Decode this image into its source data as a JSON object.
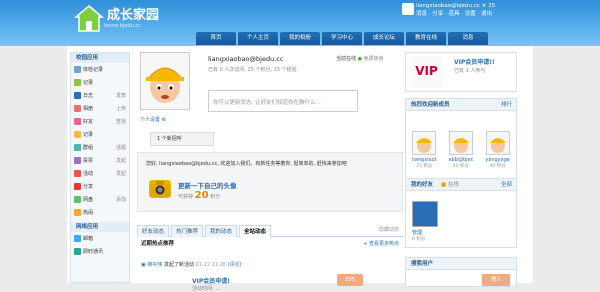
{
  "header": {
    "logo_title": "成长家园",
    "logo_sub": "home.bjedu.cc",
    "user_email": "liangxiaobao@bjedu.cc",
    "user_points": "25",
    "user_links": "消息 · 分享 · 道具 · 设置 · 退出"
  },
  "nav": [
    "首页",
    "个人主页",
    "我的相册",
    "学习中心",
    "成长论坛",
    "教育在线",
    "消息"
  ],
  "sidebar": {
    "section1": "校园应用",
    "items": [
      {
        "label": "体检记录",
        "sub": ""
      },
      {
        "label": "记录",
        "sub": ""
      },
      {
        "label": "日志",
        "sub": "发表"
      },
      {
        "label": "相册",
        "sub": "上传"
      },
      {
        "label": "好友",
        "sub": "查找"
      },
      {
        "label": "记录",
        "sub": ""
      },
      {
        "label": "群组",
        "sub": "话题"
      },
      {
        "label": "投票",
        "sub": "发起"
      },
      {
        "label": "活动",
        "sub": "发起"
      },
      {
        "label": "分享",
        "sub": ""
      },
      {
        "label": "网盘",
        "sub": "添加"
      },
      {
        "label": "热闹",
        "sub": ""
      }
    ],
    "section2": "网络应用",
    "items2": [
      {
        "label": "邮箱"
      },
      {
        "label": "即时通讯"
      }
    ]
  },
  "profile": {
    "name": "liangxiaobao@bjedu.cc",
    "stats": "已有 0 人次访问, 25 个积分, 15 个经验",
    "online_label": "当前在线",
    "online_sub": "免费转身",
    "status_placeholder": "你可以更新状态, 让好友们知道你在做什么...",
    "settings_link": "个人设置",
    "visit_count": "1",
    "visit_label": "个新招呼"
  },
  "message": {
    "line": "您好, liangxiaobao@bjedu.cc, 欢迎加入我们。有新任务等着你, 挺简单的, 赶快来参加吧",
    "update_title": "更新一下自己的头像",
    "update_sub": "可获得",
    "update_points": "20",
    "update_unit": "积分"
  },
  "tabs": [
    "好友动态",
    "热门推荐",
    "我的动态",
    "全站动态"
  ],
  "tab_right": "隐藏动态",
  "hot": {
    "title": "近期热点推荐",
    "more": "+ 查看更多热点"
  },
  "feed": {
    "who": "柳中伟",
    "text": "发起了新活动",
    "time": "01-22 21:26",
    "link": "(评论)",
    "item_title": "VIP会员申请!",
    "item_meta": "活动时间: ...",
    "badge": "335"
  },
  "right": {
    "vip_title": "VIP会员申请!!",
    "vip_sub": "已有 1 人参与",
    "hot_users_title": "热烈欢迎新成员",
    "hot_users_link": "排行",
    "users": [
      {
        "name": "liangxiaot",
        "pts": "25 积分"
      },
      {
        "name": "ebb@bjec",
        "pts": "40 积分"
      },
      {
        "name": "yangyage",
        "pts": "40 积分"
      }
    ],
    "friends_title": "我的好友",
    "friends_link": "全部",
    "friends_sub": "在线",
    "friend_name": "管理",
    "friend_pts": "0 积分",
    "search_title": "搜索用户",
    "search_btn": "搜人"
  }
}
